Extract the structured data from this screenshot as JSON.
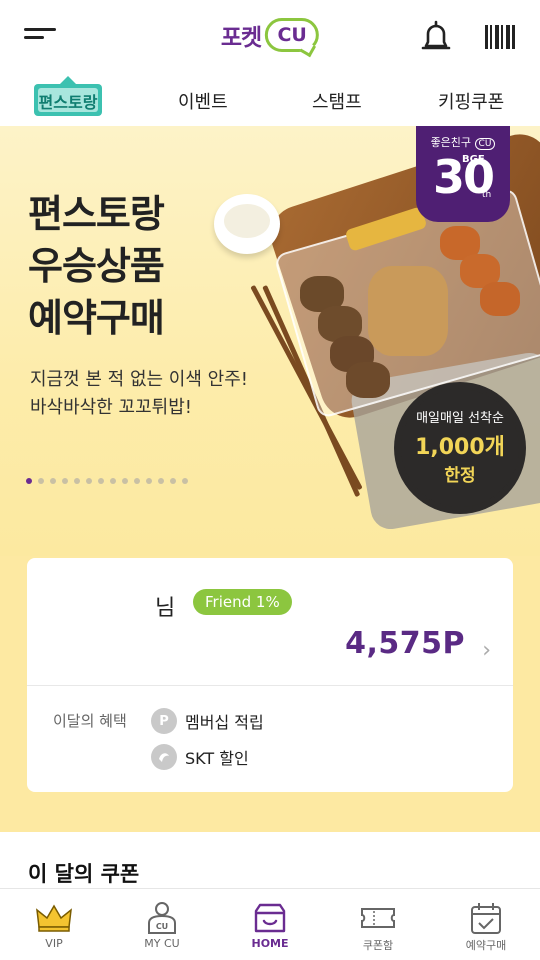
{
  "header": {
    "logo_text": "포켓",
    "logo_cu": "CU",
    "menu_icon": "hamburger-menu-icon",
    "bell_icon": "bell-icon",
    "barcode_icon": "barcode-icon"
  },
  "tabs": [
    {
      "label": "편스토랑",
      "type": "logo"
    },
    {
      "label": "이벤트"
    },
    {
      "label": "스탬프"
    },
    {
      "label": "키핑쿠폰"
    }
  ],
  "banner": {
    "title_lines": [
      "편스토랑",
      "우승상품",
      "예약구매"
    ],
    "subtitle_lines": [
      "지금껏 본 적 없는 이색 안주!",
      "바삭바삭한 꼬꼬튀밥!"
    ],
    "badge": {
      "line1": "좋은친구",
      "line1_cu": "CU",
      "number": "30",
      "brand": "BGF",
      "suffix": "th"
    },
    "seal": {
      "line1": "매일매일 선착순",
      "line2": "1,000개",
      "line3": "한정"
    },
    "page_count": 14,
    "active_page": 1
  },
  "member": {
    "name_suffix": "님",
    "grade": "Friend 1%",
    "points": "4,575P",
    "benefits_label": "이달의 혜택",
    "benefits": [
      {
        "icon": "P",
        "text": "멤버십 적립"
      },
      {
        "icon": "S",
        "text": "SKT 할인"
      }
    ]
  },
  "coupon_section": {
    "title": "이 달의 쿠폰"
  },
  "bottom_nav": [
    {
      "label": "VIP",
      "icon": "crown-icon",
      "active": false
    },
    {
      "label": "MY CU",
      "icon": "my-cu-icon",
      "active": false
    },
    {
      "label": "HOME",
      "icon": "home-store-icon",
      "active": true
    },
    {
      "label": "쿠폰함",
      "icon": "coupon-ticket-icon",
      "active": false
    },
    {
      "label": "예약구매",
      "icon": "calendar-check-icon",
      "active": false
    }
  ],
  "colors": {
    "brand_purple": "#6a2c91",
    "brand_green": "#8cc63f",
    "banner_bg": "#fdecaa",
    "points_purple": "#5a2a84"
  }
}
